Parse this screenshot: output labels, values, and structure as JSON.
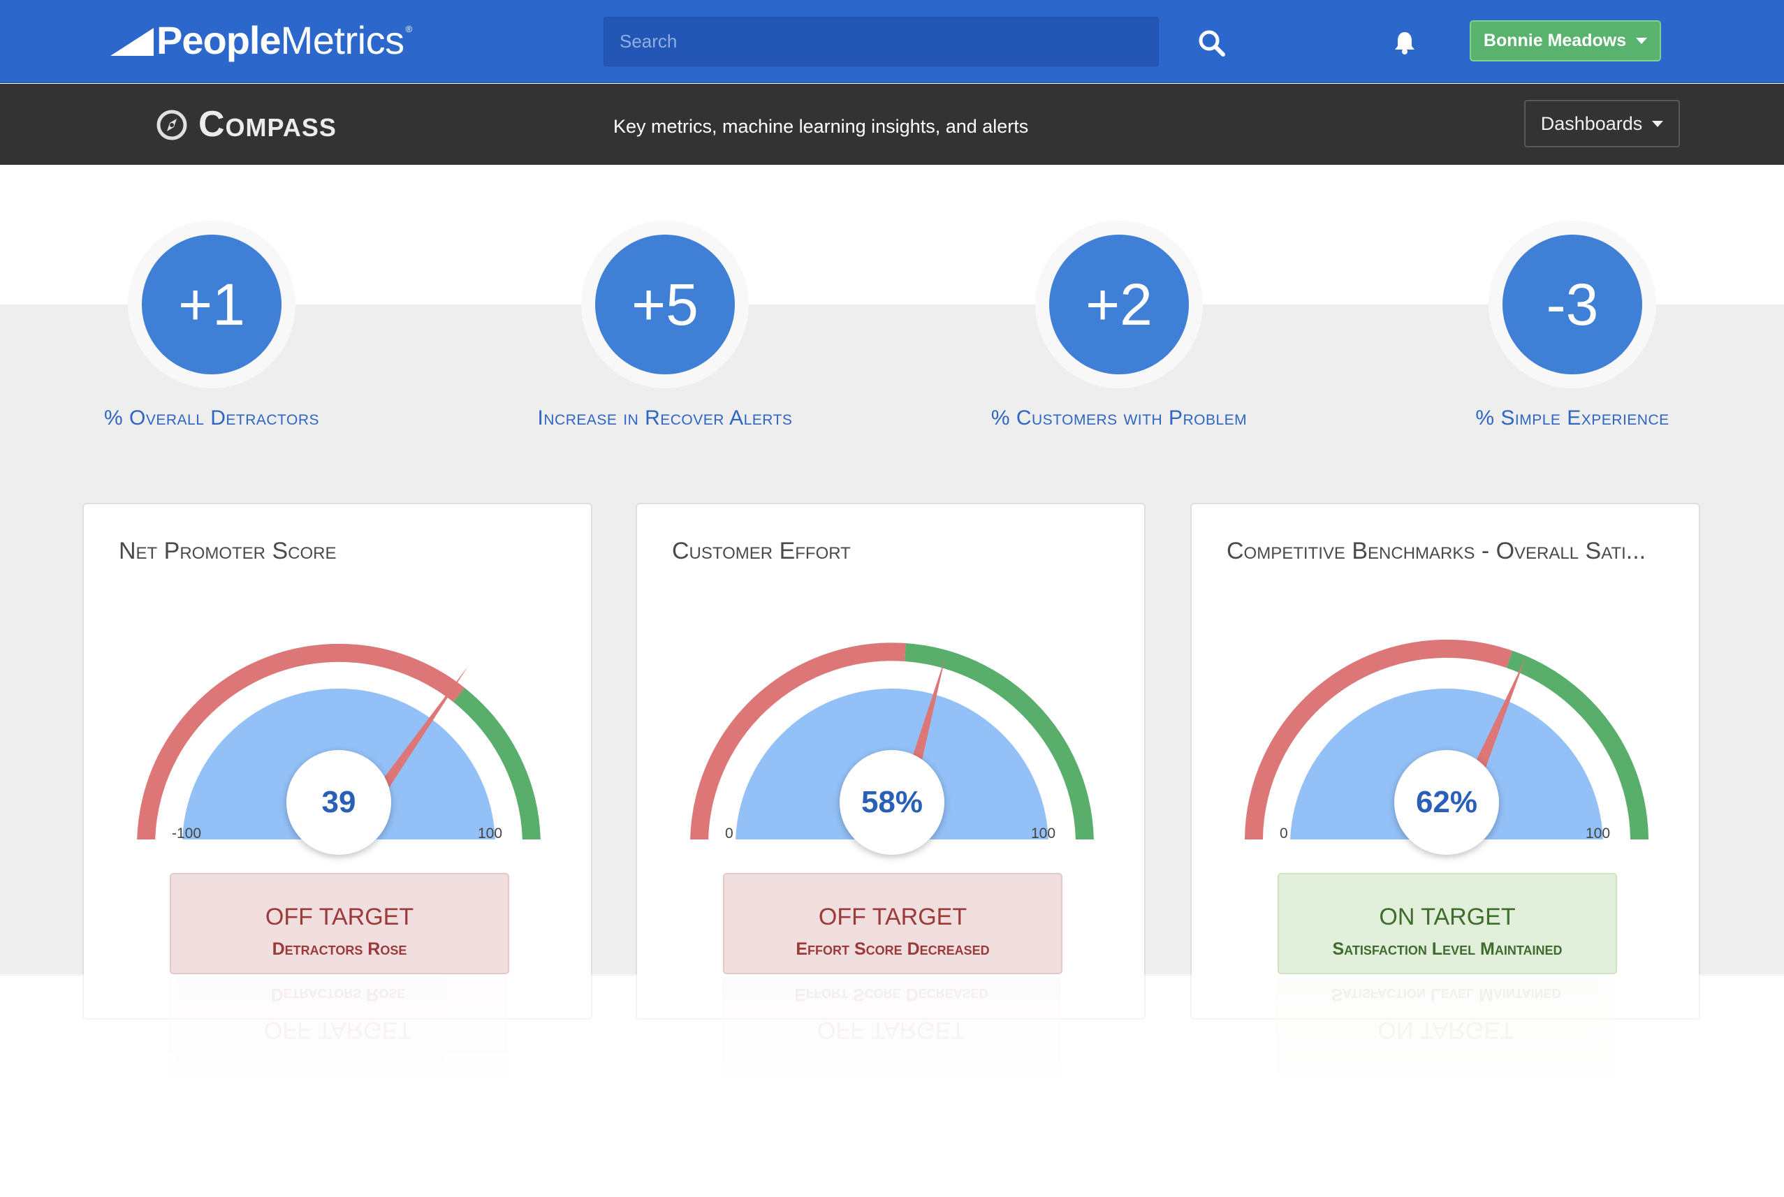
{
  "header": {
    "brand_bold": "People",
    "brand_light": "Metrics",
    "brand_mark": "®",
    "search_placeholder": "Search",
    "user_name": "Bonnie Meadows"
  },
  "subheader": {
    "app_title": "Compass",
    "subtitle": "Key metrics, machine learning insights, and alerts",
    "dashboards_label": "Dashboards"
  },
  "kpis": [
    {
      "value": "+1",
      "label": "% Overall Detractors"
    },
    {
      "value": "+5",
      "label": "Increase in Recover Alerts"
    },
    {
      "value": "+2",
      "label": "% Customers with Problem"
    },
    {
      "value": "-3",
      "label": "% Simple Experience"
    }
  ],
  "cards": [
    {
      "title": "Net Promoter Score",
      "value": "39",
      "min": "-100",
      "max": "100",
      "status": "OFF TARGET",
      "status_detail": "Detractors Rose",
      "status_type": "off"
    },
    {
      "title": "Customer Effort",
      "value": "58%",
      "min": "0",
      "max": "100",
      "status": "OFF TARGET",
      "status_detail": "Effort Score Decreased",
      "status_type": "off"
    },
    {
      "title": "Competitive Benchmarks - Overall Sati...",
      "value": "62%",
      "min": "0",
      "max": "100",
      "status": "ON TARGET",
      "status_detail": "Satisfaction Level Maintained",
      "status_type": "on"
    }
  ],
  "colors": {
    "brand_blue": "#2c67cc",
    "dark_bar": "#333333",
    "kpi_blue": "#3f7fd6",
    "gauge_fill": "#93c0f7",
    "gauge_red": "#dd7676",
    "gauge_green": "#5aae6c",
    "needle": "#dd7676",
    "user_button": "#59b26e"
  },
  "icons": {
    "search": "search-icon",
    "bell": "bell-icon",
    "compass": "compass-icon",
    "caret": "caret-down-icon"
  }
}
